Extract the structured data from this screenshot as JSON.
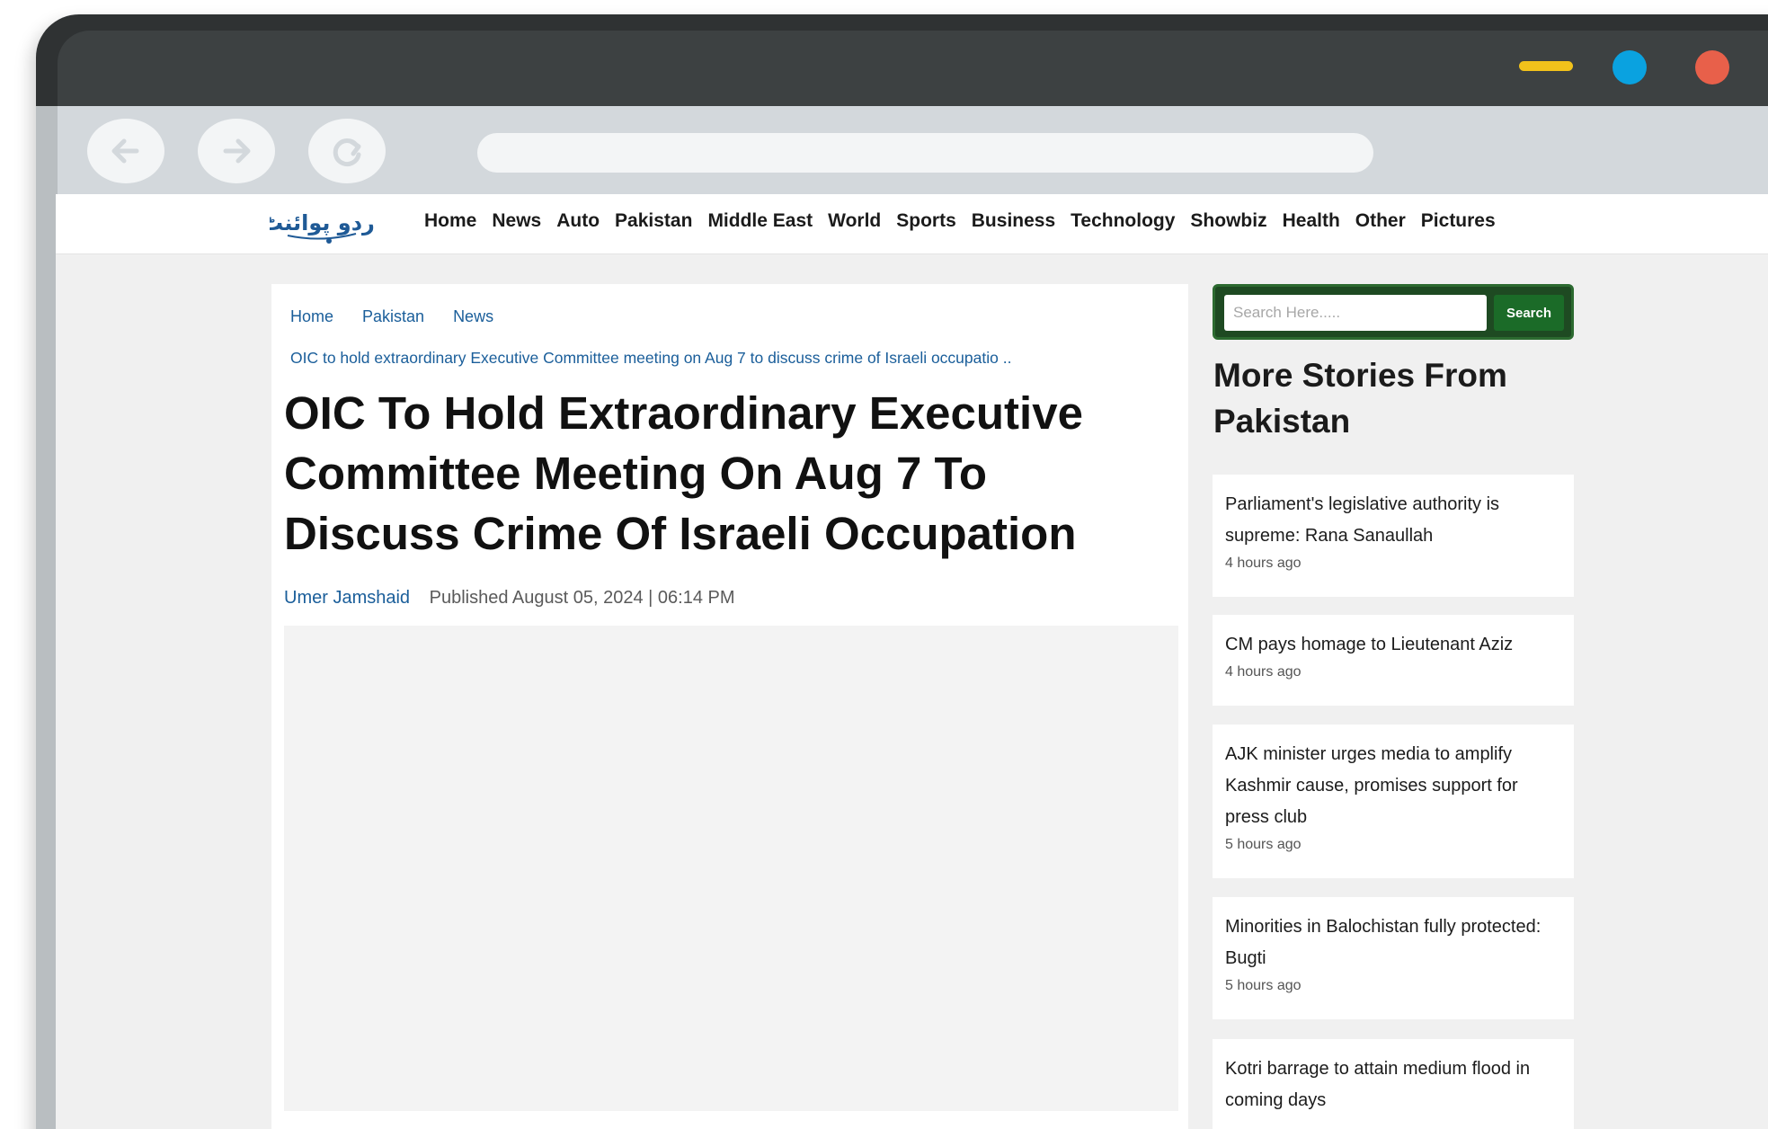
{
  "site": {
    "logo_alt": "UrduPoint logo",
    "logo_text": "اردو پوائنٹ",
    "nav": [
      "Home",
      "News",
      "Auto",
      "Pakistan",
      "Middle East",
      "World",
      "Sports",
      "Business",
      "Technology",
      "Showbiz",
      "Health",
      "Other",
      "Pictures"
    ]
  },
  "breadcrumb": {
    "items": [
      "Home",
      "Pakistan",
      "News"
    ],
    "current": "OIC to hold extraordinary Executive Committee meeting on Aug 7 to discuss crime of Israeli occupatio .."
  },
  "article": {
    "title": "OIC To Hold Extraordinary Executive Committee Meeting On Aug 7 To Discuss Crime Of Israeli Occupation",
    "author": "Umer Jamshaid",
    "published": "Published August 05, 2024 | 06:14 PM"
  },
  "sidebar": {
    "search_placeholder": "Search Here.....",
    "search_button": "Search",
    "heading": "More Stories From Pakistan",
    "stories": [
      {
        "title": "Parliament's legislative authority is supreme: Rana Sanaullah",
        "time": "4 hours ago"
      },
      {
        "title": "CM pays homage to Lieutenant Aziz",
        "time": "4 hours ago"
      },
      {
        "title": "AJK minister urges media to amplify Kashmir cause, promises support for press club",
        "time": "5 hours ago"
      },
      {
        "title": "Minorities in Balochistan fully protected: Bugti",
        "time": "5 hours ago"
      },
      {
        "title": "Kotri barrage to attain medium flood in coming days",
        "time": ""
      }
    ]
  },
  "colors": {
    "link": "#1a5e9a",
    "search_bg": "#1e4a22",
    "search_button": "#1b6b28",
    "window_min": "#f2c21b",
    "window_max": "#0aa2e0",
    "window_close": "#e8604a"
  },
  "icons": {
    "back": "arrow-left-icon",
    "forward": "arrow-right-icon",
    "reload": "reload-icon"
  }
}
